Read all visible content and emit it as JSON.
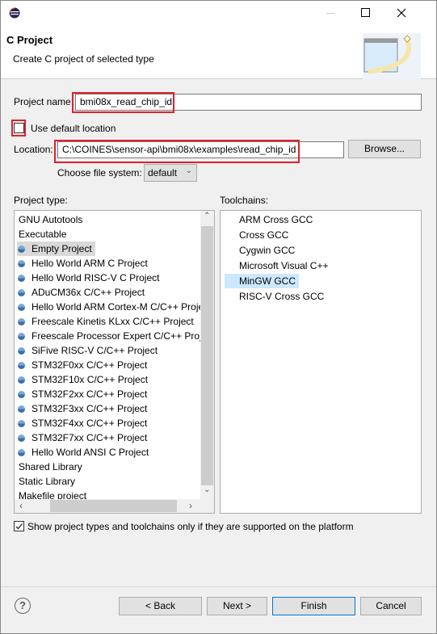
{
  "window": {
    "icon": "eclipse-icon",
    "controls": [
      "minimize",
      "maximize",
      "close"
    ]
  },
  "header": {
    "title": "C Project",
    "subtitle": "Create C project of selected type",
    "banner_icon": "new-project-wizard-icon"
  },
  "form": {
    "project_name_label": "Project name:",
    "project_name_value": "bmi08x_read_chip_id",
    "use_default_label": "Use default location",
    "use_default_checked": false,
    "location_label": "Location:",
    "location_value": "C:\\COINES\\sensor-api\\bmi08x\\examples\\read_chip_id",
    "browse_label": "Browse...",
    "filesystem_label": "Choose file system:",
    "filesystem_value": "default"
  },
  "project_type": {
    "label": "Project type:",
    "items": [
      {
        "label": "GNU Autotools",
        "icon": false
      },
      {
        "label": "Executable",
        "icon": false
      },
      {
        "label": "Empty Project",
        "icon": true,
        "selected": true
      },
      {
        "label": "Hello World ARM C Project",
        "icon": true
      },
      {
        "label": "Hello World RISC-V C Project",
        "icon": true
      },
      {
        "label": "ADuCM36x C/C++ Project",
        "icon": true
      },
      {
        "label": "Hello World ARM Cortex-M C/C++ Project",
        "icon": true
      },
      {
        "label": "Freescale Kinetis KLxx C/C++ Project",
        "icon": true
      },
      {
        "label": "Freescale Processor Expert C/C++ Project",
        "icon": true
      },
      {
        "label": "SiFive RISC-V C/C++ Project",
        "icon": true
      },
      {
        "label": "STM32F0xx C/C++ Project",
        "icon": true
      },
      {
        "label": "STM32F10x C/C++ Project",
        "icon": true
      },
      {
        "label": "STM32F2xx C/C++ Project",
        "icon": true
      },
      {
        "label": "STM32F3xx C/C++ Project",
        "icon": true
      },
      {
        "label": "STM32F4xx C/C++ Project",
        "icon": true
      },
      {
        "label": "STM32F7xx C/C++ Project",
        "icon": true
      },
      {
        "label": "Hello World ANSI C Project",
        "icon": true
      },
      {
        "label": "Shared Library",
        "icon": false
      },
      {
        "label": "Static Library",
        "icon": false
      },
      {
        "label": "Makefile project",
        "icon": false
      }
    ]
  },
  "toolchains": {
    "label": "Toolchains:",
    "items": [
      {
        "label": "ARM Cross GCC"
      },
      {
        "label": "Cross GCC"
      },
      {
        "label": "Cygwin GCC"
      },
      {
        "label": "Microsoft Visual C++"
      },
      {
        "label": "MinGW GCC",
        "selected": true
      },
      {
        "label": "RISC-V Cross GCC"
      }
    ]
  },
  "filter": {
    "label": "Show project types and toolchains only if they are supported on the platform",
    "checked": true
  },
  "buttons": {
    "help": "?",
    "back": "< Back",
    "next": "Next >",
    "finish": "Finish",
    "cancel": "Cancel"
  },
  "colors": {
    "selection": "#cce8ff",
    "highlight_box": "#e0202a",
    "default_button_border": "#0078d7"
  }
}
